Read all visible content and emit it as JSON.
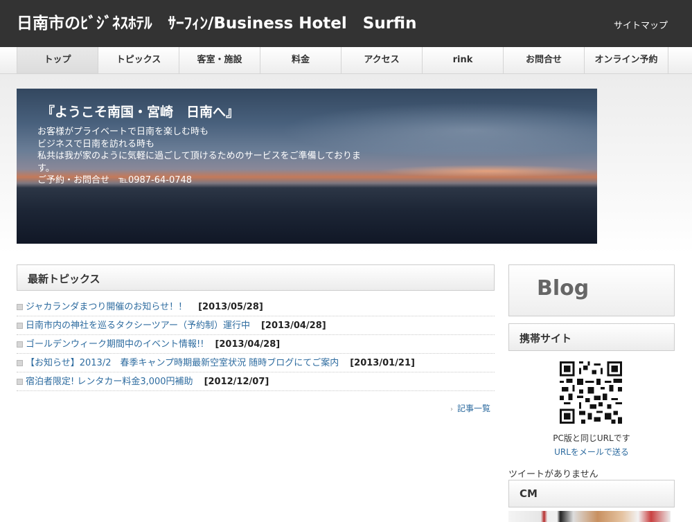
{
  "header": {
    "site_title": "日南市のﾋﾞｼﾞﾈｽﾎﾃﾙ　ｻｰﾌｨﾝ/Business Hotel　Surfin",
    "sitemap_label": "サイトマップ"
  },
  "nav": {
    "items": [
      {
        "label": "トップ"
      },
      {
        "label": "トピックス"
      },
      {
        "label": "客室・施設"
      },
      {
        "label": "料金"
      },
      {
        "label": "アクセス"
      },
      {
        "label": "rink"
      },
      {
        "label": "お問合せ"
      },
      {
        "label": "オンライン予約"
      }
    ]
  },
  "banner": {
    "heading": "『ようこそ南国・宮崎　日南へ』",
    "lines": [
      "お客様がプライベートで日南を楽しむ時も",
      "ビジネスで日南を訪れる時も",
      "私共は我が家のように気軽に過ごして頂けるためのサービスをご準備しておりま",
      "す。",
      "ご予約・お問合せ　℡0987-64-0748"
    ]
  },
  "topics": {
    "title": "最新トピックス",
    "items": [
      {
        "text": "ジャカランダまつり開催のお知らせ！！",
        "date": "[2013/05/28]"
      },
      {
        "text": "日南市内の神社を巡るタクシーツアー（予約制）運行中",
        "date": "[2013/04/28]"
      },
      {
        "text": "ゴールデンウィーク期間中のイベント情報!!",
        "date": "[2013/04/28]"
      },
      {
        "text": "【お知らせ】2013/2　春季キャンプ時期最新空室状況 随時ブログにてご案内",
        "date": "[2013/01/21]"
      },
      {
        "text": "宿泊者限定! レンタカー料金3,000円補助",
        "date": "[2012/12/07]"
      }
    ],
    "more_label": "記事一覧"
  },
  "sidebar": {
    "blog_label": "Blog",
    "mobile_title": "携帯サイト",
    "qr_caption": "PC版と同じURLです",
    "qr_mail_link": "URLをメールで送る",
    "tweet_status": "ツイートがありません",
    "cm_title": "CM"
  },
  "colors": {
    "header_bg": "#333333",
    "link": "#2d6b9f"
  }
}
